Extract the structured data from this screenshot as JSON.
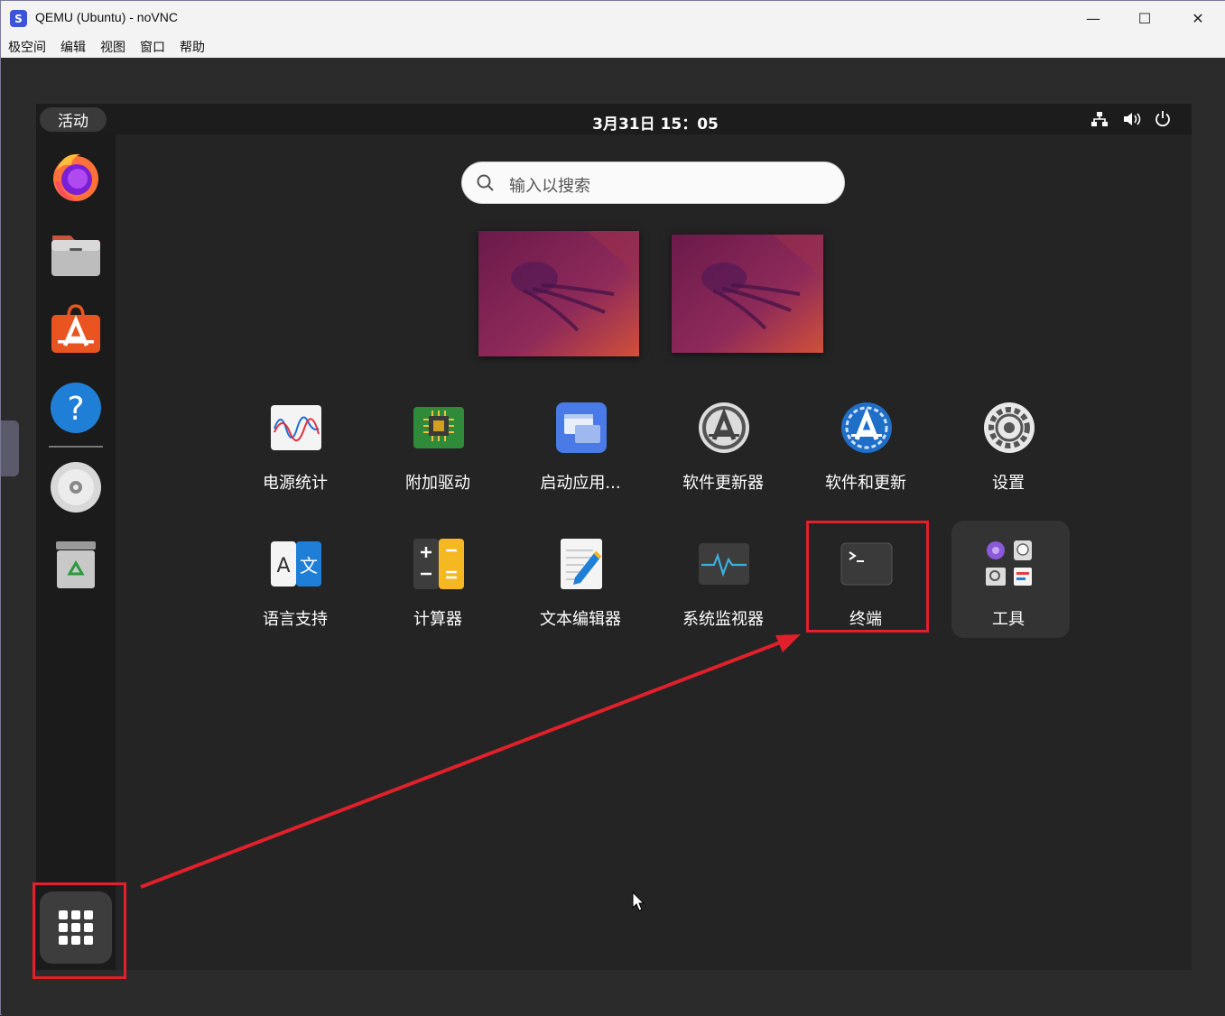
{
  "window": {
    "title": "QEMU (Ubuntu) - noVNC",
    "minimize": "—",
    "maximize": "☐",
    "close": "✕"
  },
  "menubar": {
    "items": [
      "极空间",
      "编辑",
      "视图",
      "窗口",
      "帮助"
    ]
  },
  "topbar": {
    "activities": "活动",
    "clock": "3月31日  15：05",
    "tray_icons": [
      "network-icon",
      "volume-icon",
      "power-icon"
    ]
  },
  "dock": {
    "items": [
      "firefox-icon",
      "files-icon",
      "app-center-icon",
      "help-icon",
      "dvd-icon",
      "trash-icon"
    ]
  },
  "search": {
    "placeholder": "输入以搜索"
  },
  "apps": {
    "row1": [
      {
        "label": "电源统计",
        "icon": "power-statistics-icon"
      },
      {
        "label": "附加驱动",
        "icon": "additional-drivers-icon"
      },
      {
        "label": "启动应用...",
        "icon": "startup-apps-icon"
      },
      {
        "label": "软件更新器",
        "icon": "software-updater-icon"
      },
      {
        "label": "软件和更新",
        "icon": "software-updates-icon"
      },
      {
        "label": "设置",
        "icon": "settings-icon"
      }
    ],
    "row2": [
      {
        "label": "语言支持",
        "icon": "language-support-icon"
      },
      {
        "label": "计算器",
        "icon": "calculator-icon"
      },
      {
        "label": "文本编辑器",
        "icon": "text-editor-icon"
      },
      {
        "label": "系统监视器",
        "icon": "system-monitor-icon"
      },
      {
        "label": "终端",
        "icon": "terminal-icon"
      },
      {
        "label": "工具",
        "icon": "utilities-folder-icon"
      }
    ]
  },
  "colors": {
    "annotation": "#e0202a",
    "ubuntu_orange": "#e95420"
  }
}
